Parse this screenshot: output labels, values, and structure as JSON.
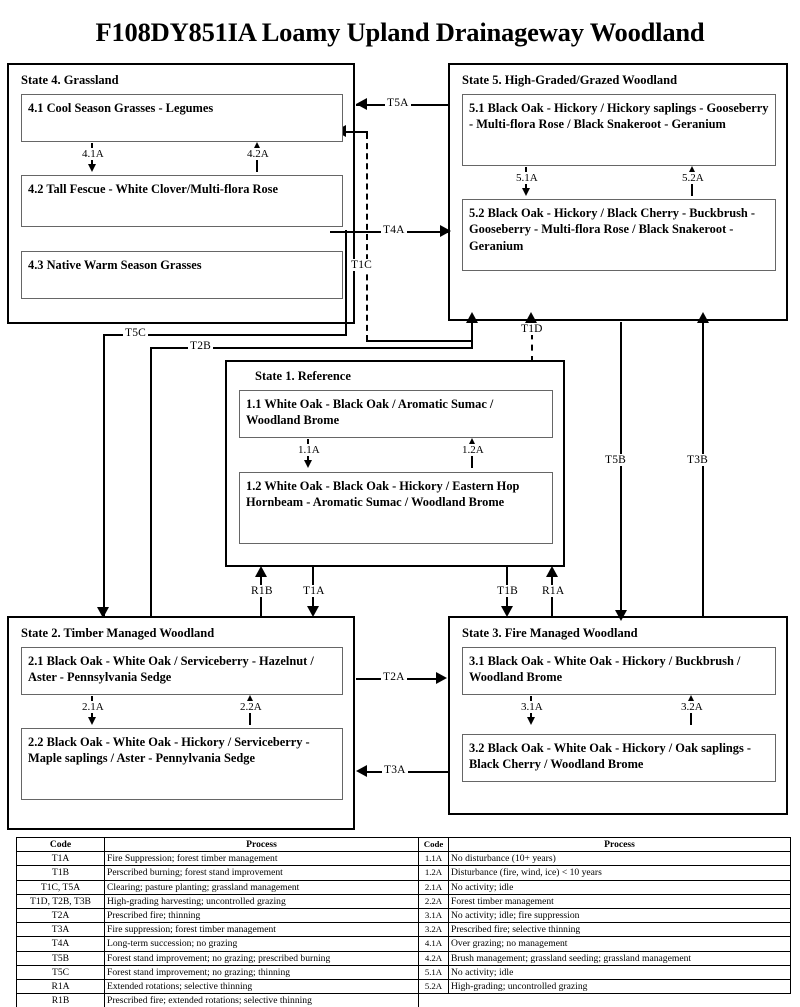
{
  "title": "F108DY851IA Loamy Upland Drainageway Woodland",
  "states": {
    "state4": {
      "title": "State 4. Grassland",
      "phases": [
        {
          "id": "4.1",
          "text": "4.1 Cool Season Grasses - Legumes"
        },
        {
          "id": "4.2",
          "text": "4.2 Tall Fescue - White Clover/Multi-flora Rose"
        },
        {
          "id": "4.3",
          "text": "4.3 Native Warm Season Grasses"
        }
      ],
      "internal_transitions": [
        {
          "code": "4.1A",
          "direction": "down"
        },
        {
          "code": "4.2A",
          "direction": "up"
        }
      ]
    },
    "state5": {
      "title": "State 5. High-Graded/Grazed Woodland",
      "phases": [
        {
          "id": "5.1",
          "text": "5.1 Black Oak - Hickory / Hickory saplings - Gooseberry - Multi-flora Rose / Black Snakeroot - Geranium"
        },
        {
          "id": "5.2",
          "text": "5.2 Black Oak - Hickory / Black Cherry - Buckbrush - Gooseberry - Multi-flora Rose / Black Snakeroot - Geranium"
        }
      ],
      "internal_transitions": [
        {
          "code": "5.1A",
          "direction": "down"
        },
        {
          "code": "5.2A",
          "direction": "up"
        }
      ]
    },
    "state1": {
      "title": "State 1. Reference",
      "phases": [
        {
          "id": "1.1",
          "text": "1.1 White Oak - Black Oak / Aromatic Sumac / Woodland Brome"
        },
        {
          "id": "1.2",
          "text": "1.2 White Oak - Black Oak - Hickory / Eastern Hop Hornbeam - Aromatic Sumac / Woodland Brome"
        }
      ],
      "internal_transitions": [
        {
          "code": "1.1A",
          "direction": "down"
        },
        {
          "code": "1.2A",
          "direction": "up"
        }
      ]
    },
    "state2": {
      "title": "State 2. Timber Managed Woodland",
      "phases": [
        {
          "id": "2.1",
          "text": "2.1 Black Oak - White Oak / Serviceberry - Hazelnut / Aster - Pennsylvania Sedge"
        },
        {
          "id": "2.2",
          "text": "2.2 Black Oak - White Oak - Hickory / Serviceberry - Maple saplings / Aster - Pennylvania Sedge"
        }
      ],
      "internal_transitions": [
        {
          "code": "2.1A",
          "direction": "down"
        },
        {
          "code": "2.2A",
          "direction": "up"
        }
      ]
    },
    "state3": {
      "title": "State 3. Fire Managed Woodland",
      "phases": [
        {
          "id": "3.1",
          "text": "3.1 Black Oak - White Oak - Hickory / Buckbrush / Woodland Brome"
        },
        {
          "id": "3.2",
          "text": "3.2 Black Oak - White Oak - Hickory / Oak saplings - Black Cherry / Woodland Brome"
        }
      ],
      "internal_transitions": [
        {
          "code": "3.1A",
          "direction": "down"
        },
        {
          "code": "3.2A",
          "direction": "up"
        }
      ]
    }
  },
  "transitions": {
    "T5A": "T5A",
    "T4A": "T4A",
    "T1C": "T1C",
    "T5C": "T5C",
    "T2B": "T2B",
    "T1D": "T1D",
    "T5B": "T5B",
    "T3B": "T3B",
    "R1B": "R1B",
    "T1A": "T1A",
    "T1B": "T1B",
    "R1A": "R1A",
    "T2A": "T2A",
    "T3A": "T3A"
  },
  "legend": {
    "headers": {
      "code": "Code",
      "process": "Process"
    },
    "left_rows": [
      {
        "code": "T1A",
        "process": "Fire Suppression; forest timber management"
      },
      {
        "code": "T1B",
        "process": "Perscribed burning; forest stand improvement"
      },
      {
        "code": "T1C, T5A",
        "process": "Clearing; pasture planting; grassland management"
      },
      {
        "code": "T1D, T2B, T3B",
        "process": "High-grading harvesting; uncontrolled grazing"
      },
      {
        "code": "T2A",
        "process": "Prescribed fire; thinning"
      },
      {
        "code": "T3A",
        "process": "Fire suppression; forest timber management"
      },
      {
        "code": "T4A",
        "process": "Long-term succession; no grazing"
      },
      {
        "code": "T5B",
        "process": "Forest stand improvement; no grazing; prescribed burning"
      },
      {
        "code": "T5C",
        "process": "Forest stand improvement; no grazing; thinning"
      },
      {
        "code": "R1A",
        "process": "Extended rotations; selective thinning"
      },
      {
        "code": "R1B",
        "process": "Prescribed fire; extended rotations; selective thinning"
      }
    ],
    "right_rows": [
      {
        "code": "1.1A",
        "process": "No disturbance (10+ years)"
      },
      {
        "code": "1.2A",
        "process": "Disturbance (fire, wind, ice) < 10 years"
      },
      {
        "code": "2.1A",
        "process": "No activity; idle"
      },
      {
        "code": "2.2A",
        "process": "Forest timber management"
      },
      {
        "code": "3.1A",
        "process": "No activity; idle; fire suppression"
      },
      {
        "code": "3.2A",
        "process": "Prescribed fire; selective thinning"
      },
      {
        "code": "4.1A",
        "process": "Over grazing; no management"
      },
      {
        "code": "4.2A",
        "process": "Brush management; grassland seeding; grassland management"
      },
      {
        "code": "5.1A",
        "process": "No activity; idle"
      },
      {
        "code": "5.2A",
        "process": "High-grading; uncontrolled grazing"
      }
    ]
  }
}
